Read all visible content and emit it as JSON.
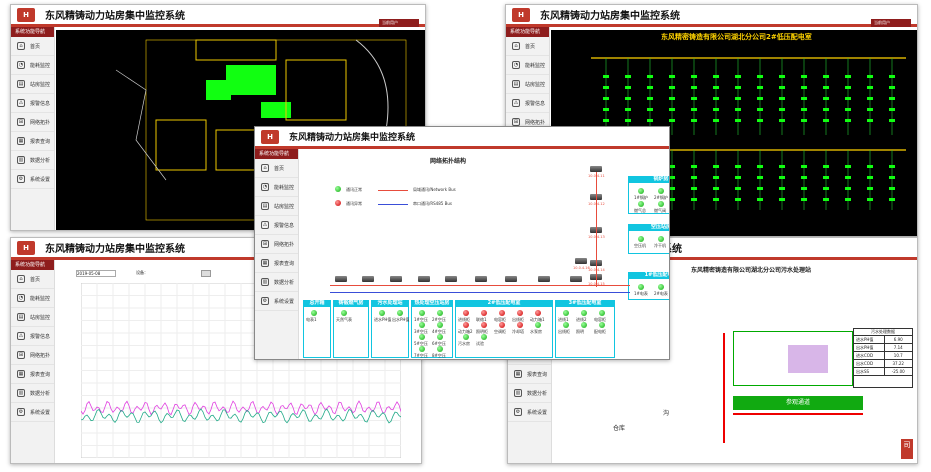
{
  "app": {
    "title": "东风精铸动力站房集中监控系统",
    "brand": "DFAC",
    "user": "当前用户"
  },
  "nav": {
    "header": "系统功能导航",
    "items": [
      "首页",
      "能耗监控",
      "站房监控",
      "报警信息",
      "网络拓扑",
      "报表查询",
      "数据分析",
      "系统设置"
    ]
  },
  "w2": {
    "title": "东风精密铸造有限公司湖北分公司2#低压配电室"
  },
  "w4": {
    "title": "东风精密铸造有限公司湖北分公司污水处理站",
    "table_title": "污水处理数据",
    "rows": [
      [
        "进水PH值",
        "6.90"
      ],
      [
        "出水PH值",
        "7.14"
      ],
      [
        "进水COD",
        "10.7"
      ],
      [
        "出水COD",
        "37.22"
      ],
      [
        "出水SS",
        "-25.00"
      ]
    ],
    "labels": [
      "参观通道",
      "仓库",
      "沟",
      "饮食"
    ]
  },
  "w3": {
    "toolbar": [
      "日期",
      "设备：",
      "保存"
    ],
    "option": "2019-05-08"
  },
  "topo": {
    "title": "网络拓扑结构",
    "legend_ok": "通讯正常",
    "legend_err": "通讯异常",
    "bus_net": "局域通讯/Network Bus",
    "bus_485": "串口通讯/RS485 Bus",
    "right_groups": [
      {
        "name": "锅炉房",
        "items": [
          "1#锅炉",
          "2#锅炉",
          "3#锅炉",
          "燃气总",
          "燃气阀",
          "污水"
        ]
      },
      {
        "name": "空压站房",
        "items": [
          "空压机",
          "冷干机"
        ]
      },
      {
        "name": "1#低压配电室",
        "items": [
          "1#电表",
          "2#电表",
          "3#电表"
        ]
      }
    ],
    "bottom": [
      {
        "name": "总开箱",
        "items": [
          "电表1"
        ]
      },
      {
        "name": "铸锻燃气房",
        "items": [
          "天然气表"
        ]
      },
      {
        "name": "污水处理站",
        "items": [
          "进水PH值",
          "出水PH值"
        ]
      },
      {
        "name": "热处理空压站房",
        "items": [
          "1#空压",
          "2#空压",
          "3#空压",
          "4#空压",
          "5#空压",
          "6#空压",
          "7#空压",
          "8#空压"
        ]
      },
      {
        "name": "2#低压配电室",
        "items": [
          "进线柜",
          "联络1",
          "电容柜",
          "出线柜",
          "动力箱1",
          "动力箱2",
          "照明柜",
          "空调柜",
          "冷却塔",
          "水泵房",
          "污水房",
          "试验"
        ]
      },
      {
        "name": "3#低压配电室",
        "items": [
          "进线1",
          "进线2",
          "电容柜",
          "出线柜",
          "照明",
          "配电柜"
        ]
      }
    ],
    "ips": [
      "10.0.4.11",
      "10.0.4.12",
      "10.0.4.13",
      "10.0.4.14",
      "10.0.4.15",
      "10.0.4.16",
      "10.0.4.17",
      "10.0.4.18",
      "10.0.4.19"
    ]
  }
}
